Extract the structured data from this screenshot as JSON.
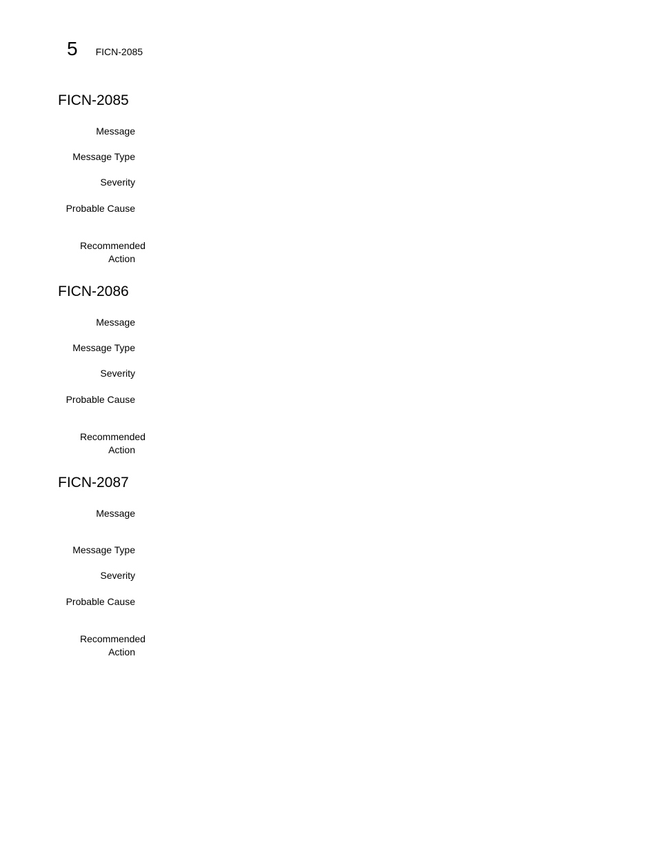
{
  "header": {
    "chapter_number": "5",
    "running_title": "FICN-2085"
  },
  "entries": [
    {
      "id": "FICN-2085",
      "fields": [
        {
          "label": "Message",
          "value": ""
        },
        {
          "label": "Message Type",
          "value": ""
        },
        {
          "label": "Severity",
          "value": ""
        },
        {
          "label": "Probable Cause",
          "value": ""
        },
        {
          "label": "Recommended Action",
          "value": ""
        }
      ]
    },
    {
      "id": "FICN-2086",
      "fields": [
        {
          "label": "Message",
          "value": ""
        },
        {
          "label": "Message Type",
          "value": ""
        },
        {
          "label": "Severity",
          "value": ""
        },
        {
          "label": "Probable Cause",
          "value": ""
        },
        {
          "label": "Recommended Action",
          "value": ""
        }
      ]
    },
    {
      "id": "FICN-2087",
      "fields": [
        {
          "label": "Message",
          "value": ""
        },
        {
          "label": "Message Type",
          "value": ""
        },
        {
          "label": "Severity",
          "value": ""
        },
        {
          "label": "Probable Cause",
          "value": ""
        },
        {
          "label": "Recommended Action",
          "value": ""
        }
      ]
    }
  ]
}
